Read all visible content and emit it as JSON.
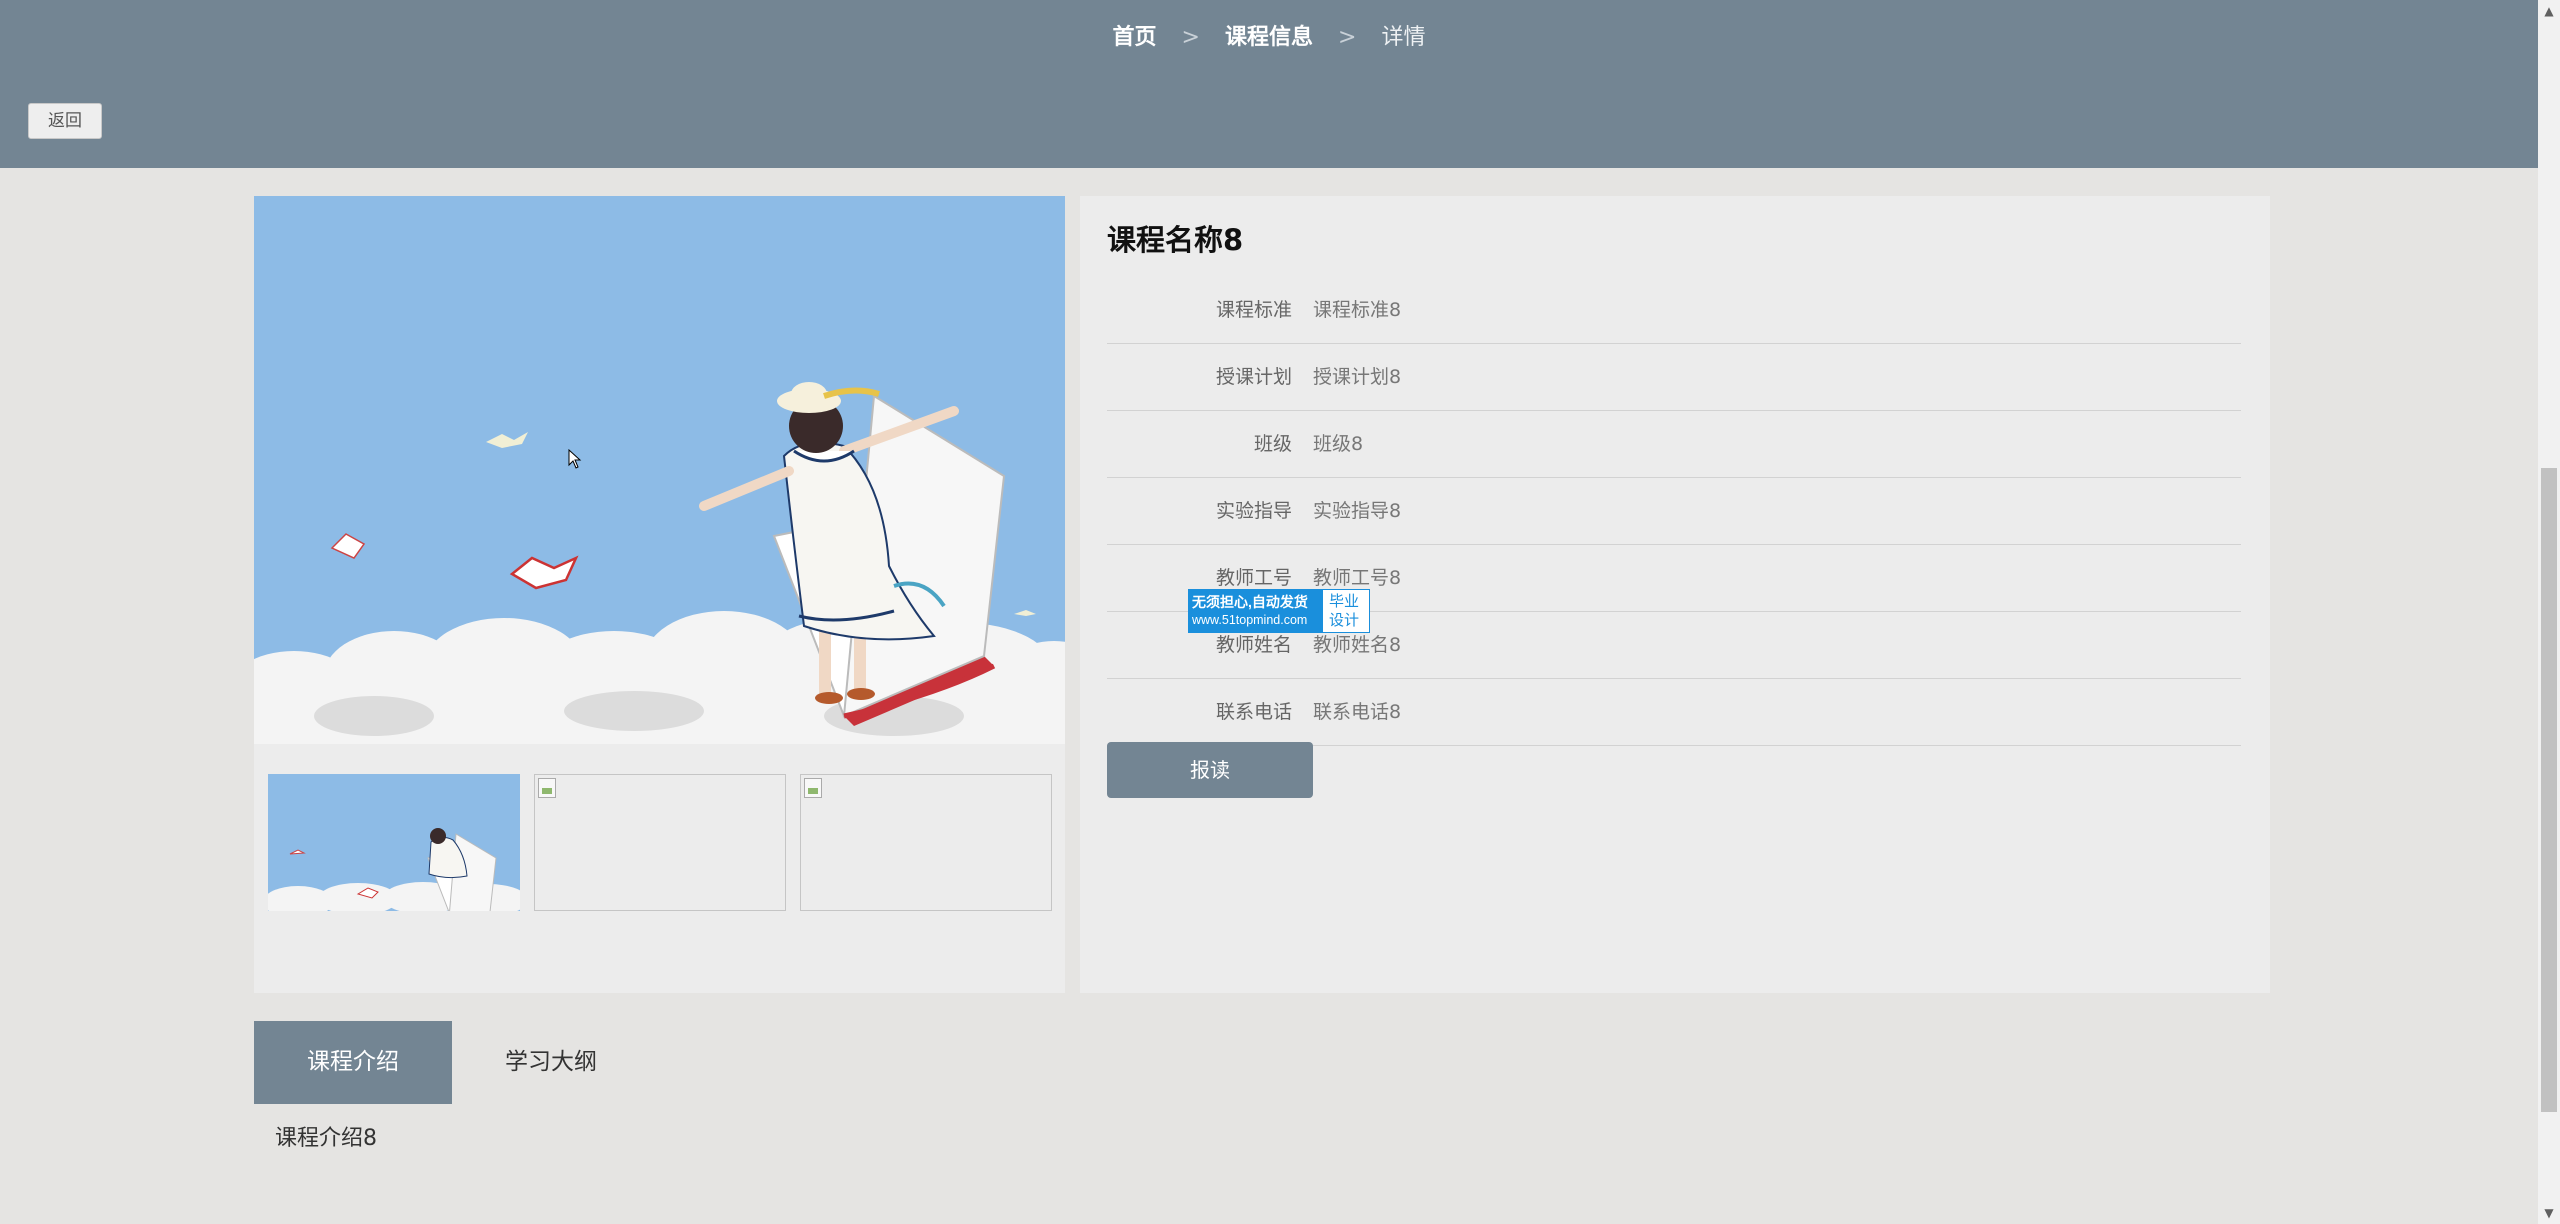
{
  "breadcrumb": {
    "home": "首页",
    "separator": ">",
    "section": "课程信息",
    "current": "详情"
  },
  "back_button": "返回",
  "course": {
    "title": "课程名称8",
    "fields": [
      {
        "label": "课程标准",
        "value": "课程标准8"
      },
      {
        "label": "授课计划",
        "value": "授课计划8"
      },
      {
        "label": "班级",
        "value": "班级8"
      },
      {
        "label": "实验指导",
        "value": "实验指导8"
      },
      {
        "label": "教师工号",
        "value": "教师工号8"
      },
      {
        "label": "教师姓名",
        "value": "教师姓名8"
      },
      {
        "label": "联系电话",
        "value": "联系电话8"
      }
    ],
    "enroll_button": "报读"
  },
  "tabs": [
    {
      "label": "课程介绍",
      "active": true
    },
    {
      "label": "学习大纲",
      "active": false
    }
  ],
  "tab_content": "课程介绍8",
  "watermark": {
    "line1": "无须担心,自动发货",
    "line2": "www.51topmind.com",
    "badge_line1": "毕业",
    "badge_line2": "设计"
  },
  "colors": {
    "header_bg": "#738593",
    "page_bg": "#e5e4e2",
    "panel_bg": "#ececec",
    "accent": "#738593"
  }
}
